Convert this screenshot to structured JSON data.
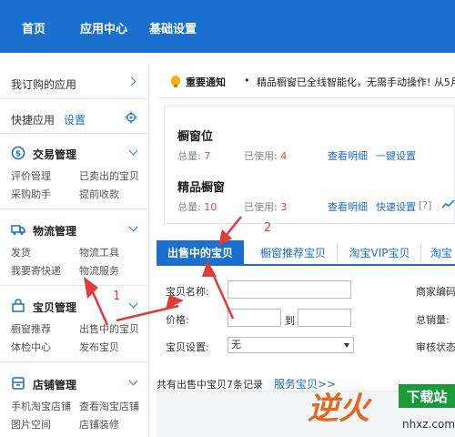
{
  "nav": {
    "items": [
      "首页",
      "应用中心",
      "基础设置"
    ]
  },
  "sidebar": {
    "subscribed": "我订购的应用",
    "quick_apps": "快捷应用",
    "settings_link": "设置",
    "sections": [
      {
        "title": "交易管理",
        "icon": "trade-icon",
        "links": [
          "评价管理",
          "已卖出的宝贝",
          "采购助手",
          "提前收款"
        ]
      },
      {
        "title": "物流管理",
        "icon": "logistics-icon",
        "links": [
          "发货",
          "物流工具",
          "我要寄快递",
          "物流服务"
        ]
      },
      {
        "title": "宝贝管理",
        "icon": "goods-icon",
        "links": [
          "橱窗推荐",
          "出售中的宝贝",
          "体检中心",
          "发布宝贝"
        ]
      },
      {
        "title": "店铺管理",
        "icon": "shop-icon",
        "links": [
          "手机淘宝店铺",
          "查看淘宝店铺",
          "图片空间",
          "店铺装修"
        ]
      }
    ]
  },
  "notice": {
    "label": "重要通知",
    "text": "精品橱窗已全线智能化，无需手动操作! 从5月"
  },
  "showcase": {
    "title": "橱窗位",
    "total_label": "总量:",
    "total": "7",
    "used_label": "已使用:",
    "used": "4",
    "link1": "查看明细",
    "link2": "一键设置"
  },
  "premium": {
    "title": "精品橱窗",
    "total_label": "总量:",
    "total": "10",
    "used_label": "已使用:",
    "used": "3",
    "link1": "查看明细",
    "link2": "快速设置",
    "help": "[?]"
  },
  "tabs": [
    "出售中的宝贝",
    "橱窗推荐宝贝",
    "淘宝VIP宝贝",
    "淘宝"
  ],
  "filters": {
    "name_label": "宝贝名称:",
    "price_label": "价格:",
    "price_to": "到",
    "setting_label": "宝贝设置:",
    "setting_value": "无",
    "code_label": "商家编码",
    "sales_label": "总销量:",
    "audit_label": "审核状态"
  },
  "results": {
    "count_text": "共有出售中宝贝7条记录",
    "service_link": "服务宝贝>>"
  },
  "annotations": [
    "1",
    "2"
  ],
  "watermark": {
    "brand": "逆火",
    "sub": "下载站",
    "domain": "nhxz.com"
  },
  "colors": {
    "nav_blue": "#1a6fcf",
    "alert_red": "#e84545",
    "arrow_red": "#e53935"
  }
}
